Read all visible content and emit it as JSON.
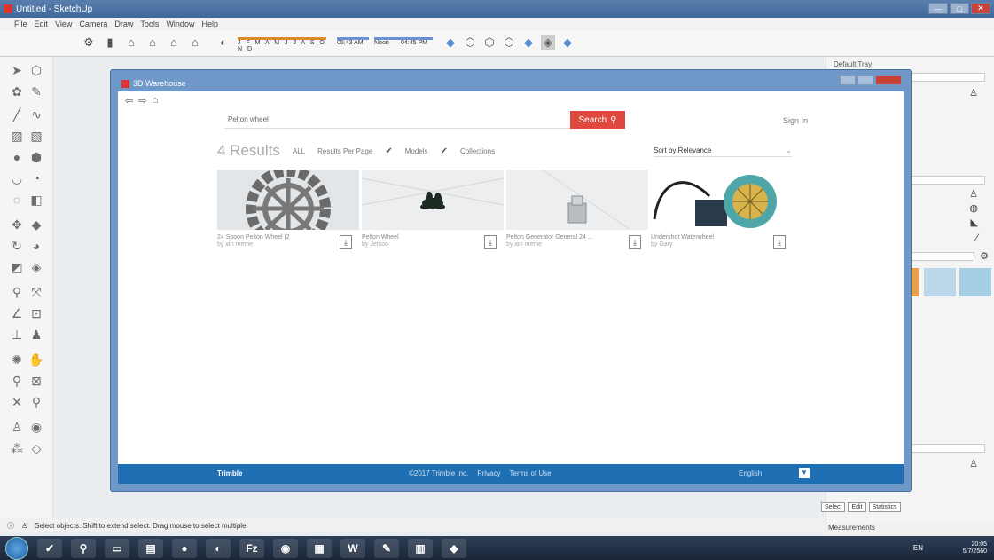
{
  "window": {
    "title": "Untitled - SketchUp",
    "buttons": [
      "—",
      "□",
      "✕"
    ]
  },
  "menu": [
    "File",
    "Edit",
    "View",
    "Camera",
    "Draw",
    "Tools",
    "Window",
    "Help"
  ],
  "toolbar": {
    "shadow_months": "J F M A M J J A S O N D",
    "time_start": "05:43 AM",
    "time_noon": "Noon",
    "time_end": "04:45 PM"
  },
  "tray": {
    "title": "Default Tray",
    "tabs": [
      "Select",
      "Edit",
      "Statistics"
    ],
    "measurements": "Measurements"
  },
  "status": {
    "text": "Select objects. Shift to extend select. Drag mouse to select multiple."
  },
  "warehouse": {
    "title": "3D Warehouse",
    "search_value": "Pelton wheel",
    "search_label": "Search",
    "signin": "Sign In",
    "results_count": "4 Results",
    "filter_all": "ALL",
    "results_per_page": "Results Per Page",
    "filter_models": "Models",
    "filter_collections": "Collections",
    "sort_by": "Sort by Relevance",
    "cards": [
      {
        "title": "24 Spoon Pelton Wheel (2",
        "sub": "by ian meme"
      },
      {
        "title": "Pelton Wheel",
        "sub": "by Jetsoo"
      },
      {
        "title": "Pelton Generator General 24 ...",
        "sub": "by ian meme"
      },
      {
        "title": "Undershot Waterwheel",
        "sub": "by Gary"
      }
    ],
    "footer": {
      "brand": "Trimble",
      "copyright": "©2017 Trimble Inc.",
      "privacy": "Privacy",
      "terms": "Terms of Use",
      "language": "English"
    }
  },
  "taskbar": {
    "lang": "EN",
    "time": "20:05",
    "date": "5/7/2560"
  },
  "colors": {
    "accent": "#e0473d",
    "footer": "#1f6fb5",
    "titlebar": "#3f6797"
  }
}
